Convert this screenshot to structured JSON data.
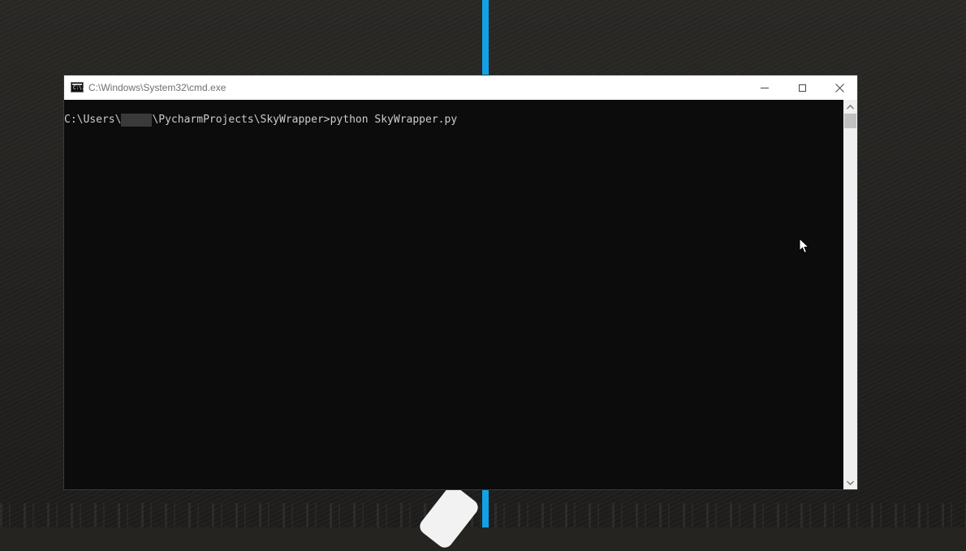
{
  "window": {
    "title": "C:\\Windows\\System32\\cmd.exe",
    "icon": "cmd-icon",
    "icon_text": "C:\\."
  },
  "console": {
    "prompt_before": "C:\\Users\\",
    "prompt_after": "\\PycharmProjects\\SkyWrapper>",
    "command": "python SkyWrapper.py"
  },
  "colors": {
    "console_bg": "#0c0c0c",
    "console_text": "#cccccc",
    "accent_blue": "#13a1e6",
    "desktop_bg": "#252421"
  }
}
